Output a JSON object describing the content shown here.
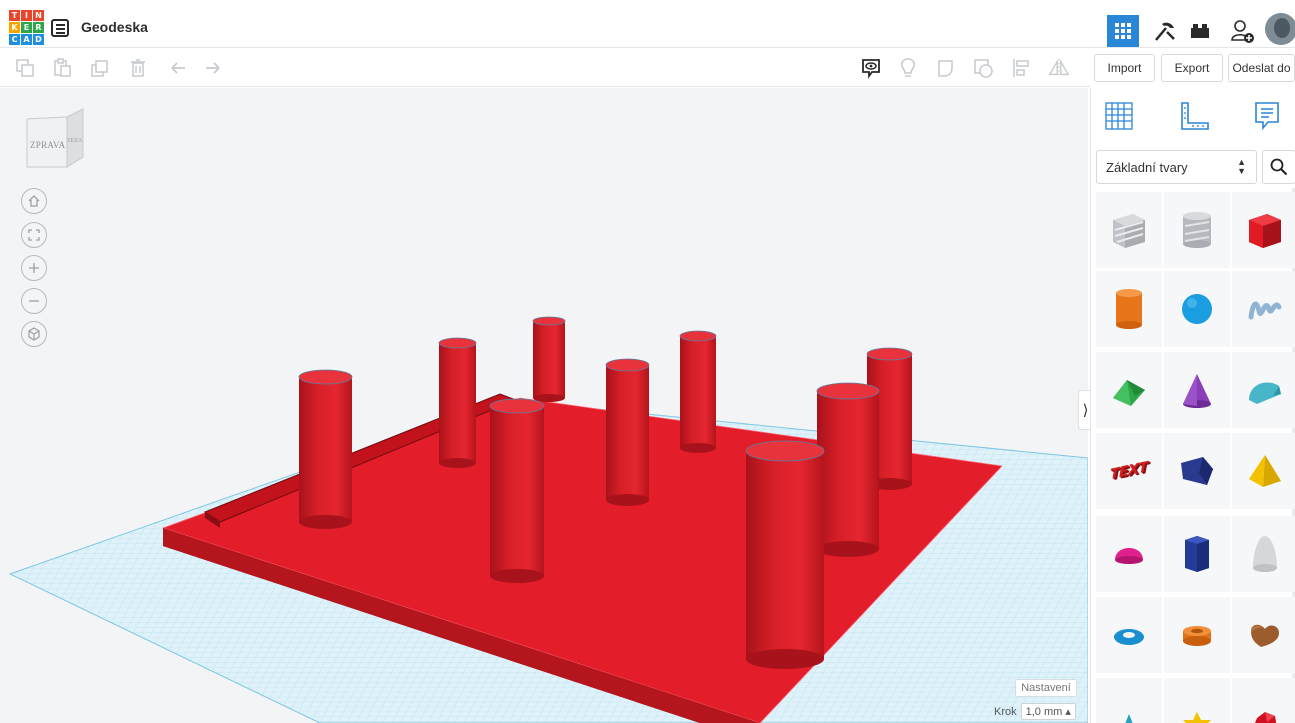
{
  "app": {
    "logo_letters": [
      "T",
      "I",
      "N",
      "K",
      "E",
      "R",
      "C",
      "A",
      "D"
    ],
    "design_title": "Geodeska",
    "mode_icons": [
      "3d-design-icon",
      "codeblocks-icon",
      "bricks-icon",
      "invite-user-icon"
    ]
  },
  "toolbar": {
    "edit_icons": [
      "copy-icon",
      "paste-icon",
      "duplicate-icon",
      "delete-icon",
      "undo-icon",
      "redo-icon"
    ],
    "view_icons": [
      "notes-icon",
      "light-bulb-icon",
      "group-icon",
      "ungroup-icon",
      "align-icon",
      "mirror-icon"
    ],
    "import_label": "Import",
    "export_label": "Export",
    "send_label": "Odeslat do"
  },
  "viewport": {
    "viewcube_front": "ZPRAVA",
    "viewcube_side": "ZEZADU",
    "nav_icons": [
      "home-view-icon",
      "fit-all-icon",
      "zoom-in-icon",
      "zoom-out-icon",
      "ortho-view-icon"
    ],
    "settings_label": "Nastavení",
    "snap_label": "Krok",
    "snap_value": "1,0 mm"
  },
  "panel": {
    "view_icons": [
      "workplane-icon",
      "ruler-icon",
      "notes-panel-icon"
    ],
    "library_label": "Základní tvary",
    "shapes": [
      {
        "name": "box-hole",
        "color": "#b5b9bd"
      },
      {
        "name": "cylinder-hole",
        "color": "#b5b9bd"
      },
      {
        "name": "box",
        "color": "#e01b24"
      },
      {
        "name": "cylinder",
        "color": "#f07f1b"
      },
      {
        "name": "sphere",
        "color": "#1a9ee0"
      },
      {
        "name": "scribble",
        "color": "#8fb4d4"
      },
      {
        "name": "roof",
        "color": "#2ea64a"
      },
      {
        "name": "cone",
        "color": "#8a3fb8"
      },
      {
        "name": "round-roof",
        "color": "#46b6c8"
      },
      {
        "name": "text",
        "color": "#d02020"
      },
      {
        "name": "wedge",
        "color": "#2a3a8f"
      },
      {
        "name": "pyramid",
        "color": "#f2c200"
      },
      {
        "name": "half-sphere",
        "color": "#e0208e"
      },
      {
        "name": "polygon",
        "color": "#233c9a"
      },
      {
        "name": "paraboloid",
        "color": "#d5d7da"
      },
      {
        "name": "torus",
        "color": "#1a8fd0"
      },
      {
        "name": "tube",
        "color": "#f07f1b"
      },
      {
        "name": "heart",
        "color": "#9c5c2e"
      },
      {
        "name": "star",
        "color": "#2a9fc4"
      },
      {
        "name": "star-6",
        "color": "#f2c200"
      },
      {
        "name": "gem",
        "color": "#d01020"
      }
    ],
    "text_shape_label": "TEXT"
  }
}
